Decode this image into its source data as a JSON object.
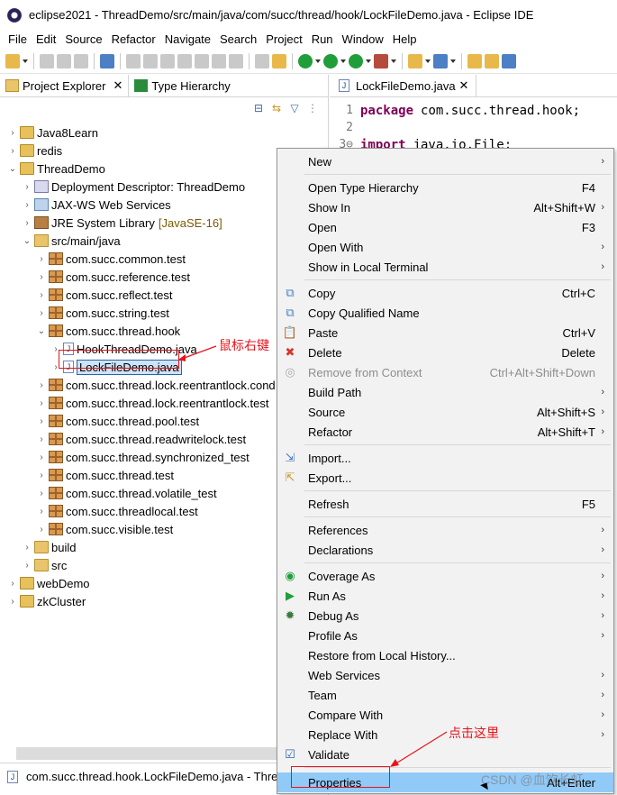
{
  "window": {
    "title": "eclipse2021 - ThreadDemo/src/main/java/com/succ/thread/hook/LockFileDemo.java - Eclipse IDE"
  },
  "menubar": [
    "File",
    "Edit",
    "Source",
    "Refactor",
    "Navigate",
    "Search",
    "Project",
    "Run",
    "Window",
    "Help"
  ],
  "left_panel": {
    "tabs": [
      {
        "label": "Project Explorer",
        "close": "✕"
      },
      {
        "label": "Type Hierarchy"
      }
    ],
    "tree": [
      {
        "label": "Java8Learn",
        "icon": "project-icon",
        "arrow": "›"
      },
      {
        "label": "redis",
        "icon": "project-icon",
        "arrow": "›"
      },
      {
        "label": "ThreadDemo",
        "icon": "project-icon",
        "arrow": "⌄"
      },
      {
        "label": "Deployment Descriptor: ThreadDemo",
        "icon": "deployment-descriptor-icon",
        "arrow": "›"
      },
      {
        "label": "JAX-WS Web Services",
        "icon": "web-services-icon",
        "arrow": "›"
      },
      {
        "label": "JRE System Library",
        "tag": "[JavaSE-16]",
        "icon": "library-icon",
        "arrow": "›"
      },
      {
        "label": "src/main/java",
        "icon": "source-folder-icon",
        "arrow": "⌄"
      },
      {
        "label": "com.succ.common.test",
        "icon": "package-icon",
        "arrow": "›"
      },
      {
        "label": "com.succ.reference.test",
        "icon": "package-icon",
        "arrow": "›"
      },
      {
        "label": "com.succ.reflect.test",
        "icon": "package-icon",
        "arrow": "›"
      },
      {
        "label": "com.succ.string.test",
        "icon": "package-icon",
        "arrow": "›"
      },
      {
        "label": "com.succ.thread.hook",
        "icon": "package-icon",
        "arrow": "⌄"
      },
      {
        "label": "HookThreadDemo.java",
        "icon": "java-file-icon",
        "arrow": "›"
      },
      {
        "label": "LockFileDemo.java",
        "icon": "java-file-icon",
        "arrow": "›",
        "selected": true
      },
      {
        "label": "com.succ.thread.lock.reentrantlock.cond",
        "icon": "package-icon",
        "arrow": "›"
      },
      {
        "label": "com.succ.thread.lock.reentrantlock.test",
        "icon": "package-icon",
        "arrow": "›"
      },
      {
        "label": "com.succ.thread.pool.test",
        "icon": "package-icon",
        "arrow": "›"
      },
      {
        "label": "com.succ.thread.readwritelock.test",
        "icon": "package-icon",
        "arrow": "›"
      },
      {
        "label": "com.succ.thread.synchronized_test",
        "icon": "package-icon",
        "arrow": "›"
      },
      {
        "label": "com.succ.thread.test",
        "icon": "package-icon",
        "arrow": "›"
      },
      {
        "label": "com.succ.thread.volatile_test",
        "icon": "package-icon",
        "arrow": "›"
      },
      {
        "label": "com.succ.threadlocal.test",
        "icon": "package-icon",
        "arrow": "›"
      },
      {
        "label": "com.succ.visible.test",
        "icon": "package-icon",
        "arrow": "›"
      },
      {
        "label": "build",
        "icon": "folder-icon",
        "arrow": "›"
      },
      {
        "label": "src",
        "icon": "folder-icon",
        "arrow": "›"
      },
      {
        "label": "webDemo",
        "icon": "project-icon",
        "arrow": "›"
      },
      {
        "label": "zkCluster",
        "icon": "project-icon",
        "arrow": "›"
      }
    ],
    "status": "com.succ.thread.hook.LockFileDemo.java - Threa"
  },
  "editor": {
    "tab": {
      "label": "LockFileDemo.java",
      "close": "✕"
    },
    "lines": [
      {
        "num": "1",
        "keyword": "package",
        "text": "com.succ.thread.hook;"
      },
      {
        "num": "2",
        "keyword": "",
        "text": ""
      },
      {
        "num": "3⊖",
        "keyword": "import",
        "text": "java.io.File;"
      }
    ]
  },
  "context_menu": {
    "items": [
      {
        "label": "New",
        "submenu": "›"
      },
      {
        "sep": true
      },
      {
        "label": "Open Type Hierarchy",
        "shortcut": "F4"
      },
      {
        "label": "Show In",
        "shortcut": "Alt+Shift+W",
        "submenu": "›"
      },
      {
        "label": "Open",
        "shortcut": "F3"
      },
      {
        "label": "Open With",
        "submenu": "›"
      },
      {
        "label": "Show in Local Terminal",
        "submenu": "›"
      },
      {
        "sep": true
      },
      {
        "label": "Copy",
        "shortcut": "Ctrl+C",
        "icon": "copy-icon"
      },
      {
        "label": "Copy Qualified Name",
        "icon": "copy-qualified-name-icon"
      },
      {
        "label": "Paste",
        "shortcut": "Ctrl+V",
        "icon": "paste-icon"
      },
      {
        "label": "Delete",
        "shortcut": "Delete",
        "icon": "delete-icon"
      },
      {
        "label": "Remove from Context",
        "shortcut": "Ctrl+Alt+Shift+Down",
        "icon": "remove-context-icon",
        "disabled": true
      },
      {
        "label": "Build Path",
        "submenu": "›"
      },
      {
        "label": "Source",
        "shortcut": "Alt+Shift+S",
        "submenu": "›"
      },
      {
        "label": "Refactor",
        "shortcut": "Alt+Shift+T",
        "submenu": "›"
      },
      {
        "sep": true
      },
      {
        "label": "Import...",
        "icon": "import-icon"
      },
      {
        "label": "Export...",
        "icon": "export-icon"
      },
      {
        "sep": true
      },
      {
        "label": "Refresh",
        "shortcut": "F5"
      },
      {
        "sep": true
      },
      {
        "label": "References",
        "submenu": "›"
      },
      {
        "label": "Declarations",
        "submenu": "›"
      },
      {
        "sep": true
      },
      {
        "label": "Coverage As",
        "submenu": "›",
        "icon": "coverage-icon"
      },
      {
        "label": "Run As",
        "submenu": "›",
        "icon": "run-icon"
      },
      {
        "label": "Debug As",
        "submenu": "›",
        "icon": "debug-icon"
      },
      {
        "label": "Profile As",
        "submenu": "›"
      },
      {
        "label": "Restore from Local History..."
      },
      {
        "label": "Web Services",
        "submenu": "›"
      },
      {
        "label": "Team",
        "submenu": "›"
      },
      {
        "label": "Compare With",
        "submenu": "›"
      },
      {
        "label": "Replace With",
        "submenu": "›"
      },
      {
        "label": "Validate",
        "icon": "checkbox-icon"
      },
      {
        "sep": true
      },
      {
        "label": "Properties",
        "shortcut": "Alt+Enter",
        "highlighted": true
      }
    ]
  },
  "annotations": {
    "right_click_note": "鼠标右键",
    "click_here_note": "点击这里",
    "watermark": "CSDN @血饮长虹"
  },
  "colors": {
    "menu_highlight": "#91c9f7",
    "annotation_red": "#e8141c",
    "keyword": "#7f0055"
  }
}
